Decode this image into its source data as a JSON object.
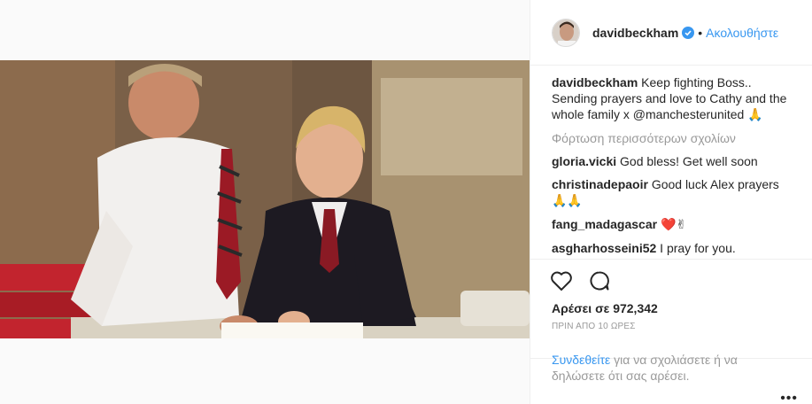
{
  "post": {
    "username": "davidbeckham",
    "follow_label": "Ακολουθήστε",
    "caption_user": "davidbeckham",
    "caption_text": "Keep fighting Boss.. Sending prayers and love to Cathy and the whole family x @manchesterunited",
    "caption_emoji": "🙏",
    "load_more": "Φόρτωση περισσότερων σχολίων",
    "comments": [
      {
        "user": "gloria.vicki",
        "text": "God bless! Get well soon",
        "emoji": ""
      },
      {
        "user": "christinadepaoir",
        "text": "Good luck Alex prayers",
        "emoji": "🙏🙏"
      },
      {
        "user": "fang_madagascar",
        "text": "",
        "emoji": "❤️✌"
      },
      {
        "user": "asgharhosseini52",
        "text": "I pray for you.",
        "emoji": ""
      }
    ],
    "likes_label": "Αρέσει σε 972,342",
    "time_label": "ΠΡΙΝ ΑΠΟ 10 ΩΡΕΣ",
    "login_link": "Συνδεθείτε",
    "login_text": " για να σχολιάσετε ή να δηλώσετε ότι σας αρέσει.",
    "more_options": "•••"
  },
  "colors": {
    "accent": "#3897f0",
    "muted": "#999999",
    "text": "#262626",
    "heart": "#ed4956"
  },
  "icons": {
    "like": "heart-outline-icon",
    "comment": "comment-bubble-icon",
    "verified": "verified-badge-icon",
    "more": "more-options-icon"
  }
}
